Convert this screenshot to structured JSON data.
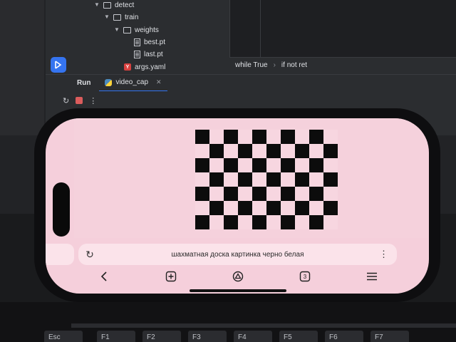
{
  "ide": {
    "tree": {
      "items": [
        {
          "label": "detect",
          "kind": "folder",
          "depth": 0
        },
        {
          "label": "train",
          "kind": "folder",
          "depth": 1
        },
        {
          "label": "weights",
          "kind": "folder",
          "depth": 2
        },
        {
          "label": "best.pt",
          "kind": "file",
          "depth": 3
        },
        {
          "label": "last.pt",
          "kind": "file",
          "depth": 3
        },
        {
          "label": "args.yaml",
          "kind": "yaml",
          "depth": 2
        }
      ]
    },
    "breadcrumb": [
      "while True",
      "if not ret"
    ],
    "run_panel": {
      "title": "Run",
      "tab_label": "video_cap"
    },
    "colors": {
      "stop": "#db5c5c",
      "tab_underline": "#3574f0"
    }
  },
  "phone": {
    "browser": {
      "query": "шахматная доска картинка черно белая",
      "nav_icons": [
        "back-icon",
        "new-tab-icon",
        "home-icon",
        "tabs-icon",
        "menu-icon"
      ],
      "tab_count": "3"
    },
    "checkerboard": {
      "columns": 10,
      "rows": 7,
      "first_square": "black"
    }
  },
  "keyboard": {
    "keys": [
      "Esc",
      "F1",
      "F2",
      "F3",
      "F4",
      "F5",
      "F6",
      "F7"
    ]
  }
}
